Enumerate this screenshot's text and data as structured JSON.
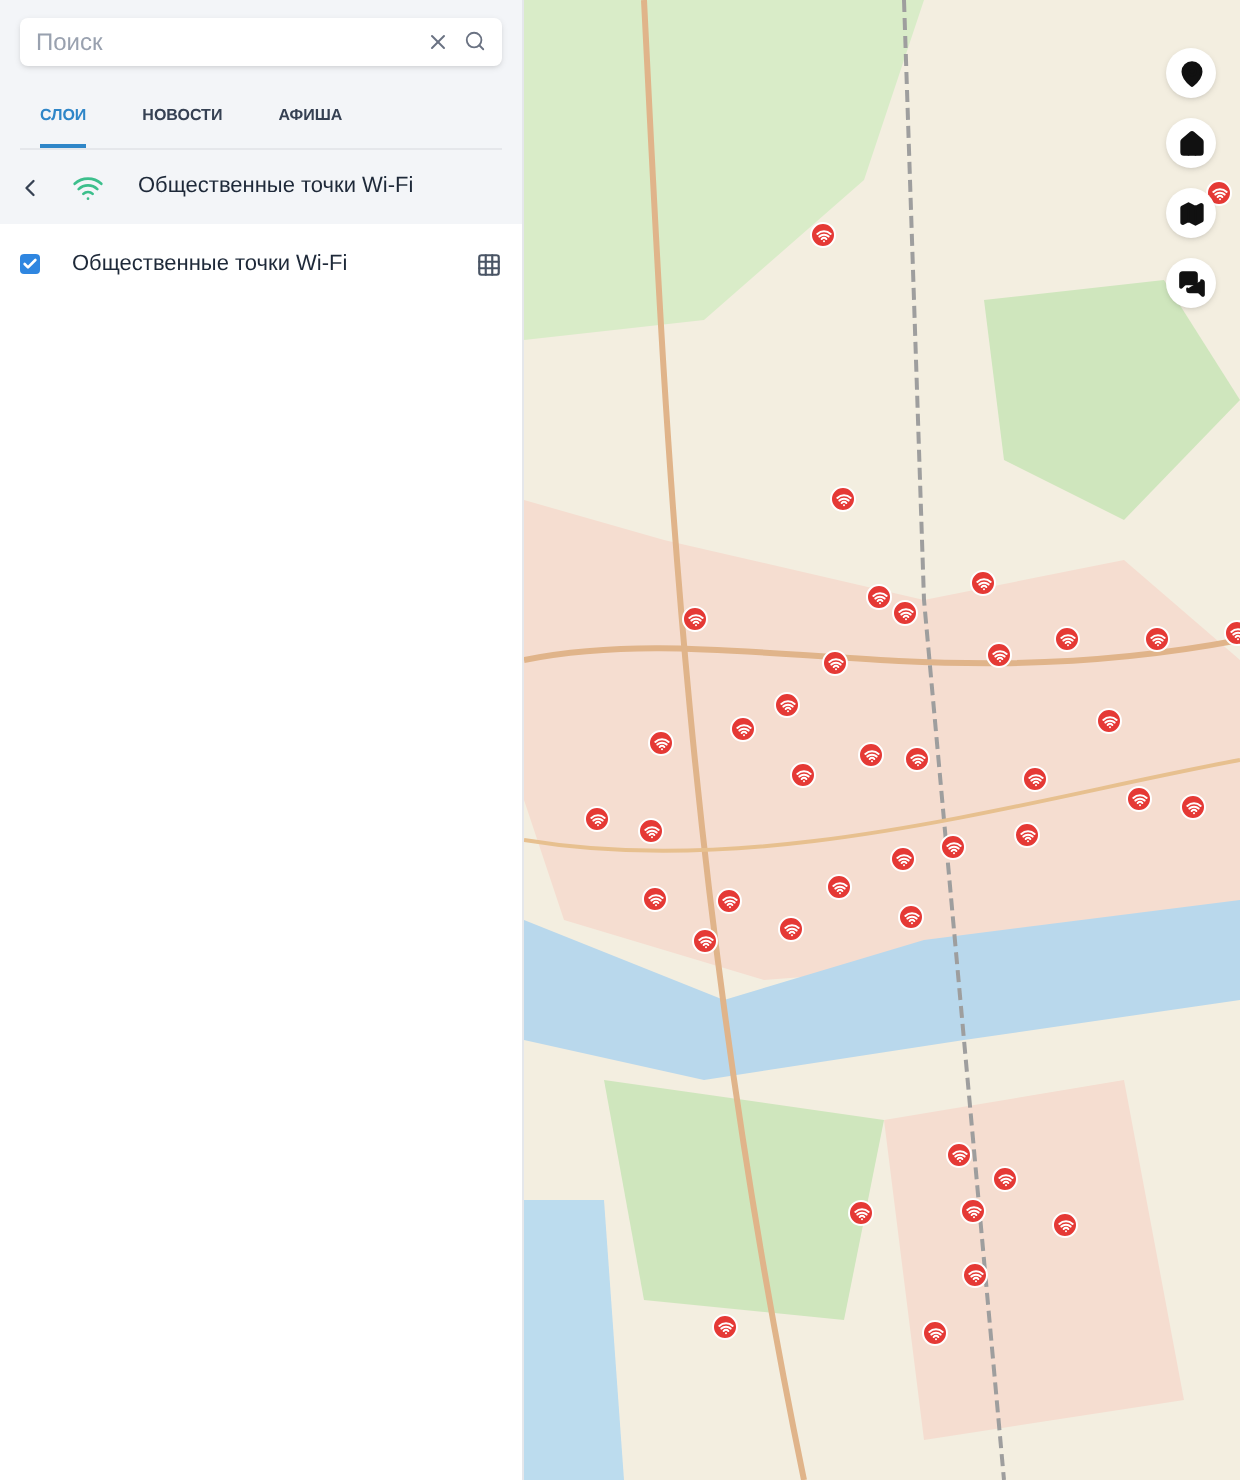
{
  "search": {
    "placeholder": "Поиск"
  },
  "tabs": [
    {
      "label": "СЛОИ",
      "selected": true
    },
    {
      "label": "НОВОСТИ",
      "selected": false
    },
    {
      "label": "АФИША",
      "selected": false
    }
  ],
  "layer_header": {
    "title": "Общественные точки Wi-Fi"
  },
  "layers": [
    {
      "label": "Общественные точки Wi-Fi",
      "checked": true
    }
  ]
}
